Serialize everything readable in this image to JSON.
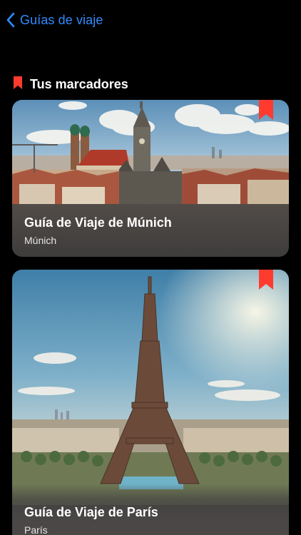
{
  "nav": {
    "back_label": "Guías de viaje",
    "back_icon": "chevron-left-icon"
  },
  "section": {
    "title": "Tus marcadores",
    "icon": "bookmark-icon"
  },
  "guides": [
    {
      "title": "Guía de Viaje de Múnich",
      "city": "Múnich",
      "bookmarked": true
    },
    {
      "title": "Guía de Viaje de París",
      "city": "París",
      "bookmarked": true
    }
  ],
  "colors": {
    "accent": "#2f8cff",
    "bookmark": "#ff3b30",
    "background": "#000000",
    "card": "#3c3c3e"
  }
}
